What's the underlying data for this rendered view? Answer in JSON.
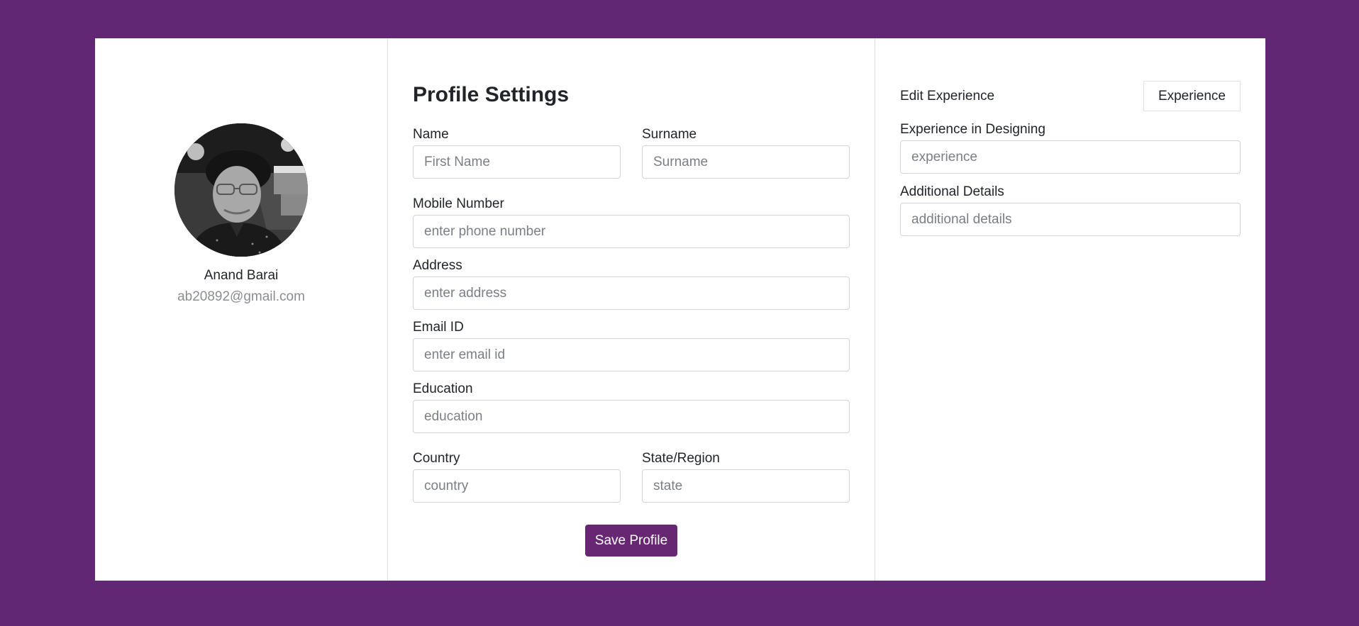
{
  "profile": {
    "name": "Anand Barai",
    "email": "ab20892@gmail.com"
  },
  "settings": {
    "title": "Profile Settings",
    "fields": {
      "first_name": {
        "label": "Name",
        "placeholder": "First Name"
      },
      "surname": {
        "label": "Surname",
        "placeholder": "Surname"
      },
      "mobile": {
        "label": "Mobile Number",
        "placeholder": "enter phone number"
      },
      "address": {
        "label": "Address",
        "placeholder": "enter address"
      },
      "email": {
        "label": "Email ID",
        "placeholder": "enter email id"
      },
      "education": {
        "label": "Education",
        "placeholder": "education"
      },
      "country": {
        "label": "Country",
        "placeholder": "country"
      },
      "state": {
        "label": "State/Region",
        "placeholder": "state"
      }
    },
    "save_label": "Save Profile"
  },
  "experience": {
    "title": "Edit Experience",
    "button_label": "Experience",
    "fields": {
      "designing": {
        "label": "Experience in Designing",
        "placeholder": "experience"
      },
      "additional": {
        "label": "Additional Details",
        "placeholder": "additional details"
      }
    }
  },
  "colors": {
    "background": "#612774",
    "accent": "#682773"
  }
}
